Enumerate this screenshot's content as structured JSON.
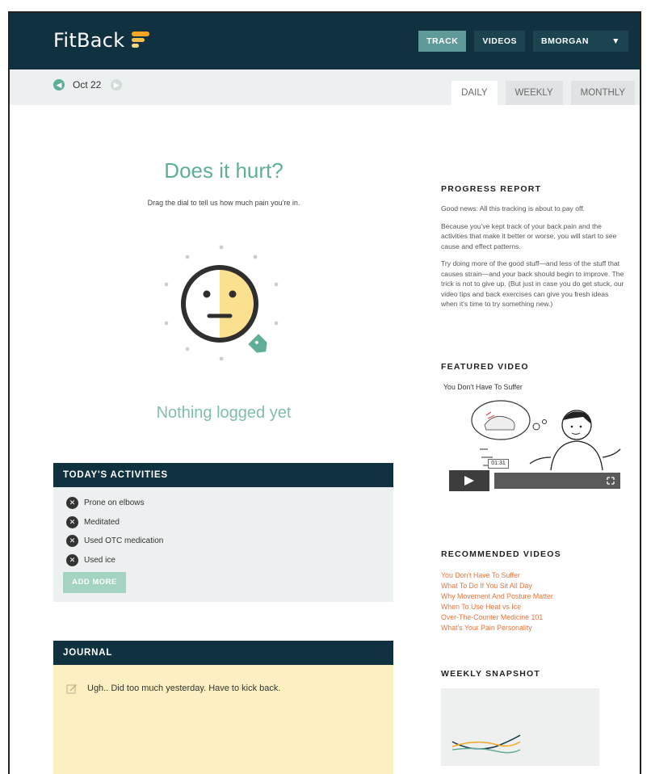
{
  "brand": {
    "name": "FitBack"
  },
  "nav": {
    "track": "TRACK",
    "videos": "VIDEOS",
    "user": "BMORGAN",
    "user_caret": "▼"
  },
  "datebar": {
    "date": "Oct 22",
    "tabs": [
      "DAILY",
      "WEEKLY",
      "MONTHLY"
    ],
    "active_tab": "DAILY"
  },
  "pain": {
    "title": "Does it hurt?",
    "instruction": "Drag the dial to tell us how much pain you're in.",
    "dial_value": "4",
    "status": "Nothing logged yet"
  },
  "activities": {
    "header": "TODAY'S ACTIVITIES",
    "items": [
      "Prone on elbows",
      "Meditated",
      "Used OTC medication",
      "Used ice"
    ],
    "add_more": "ADD MORE"
  },
  "journal": {
    "header": "JOURNAL",
    "entry": "Ugh.. Did too much yesterday. Have to kick back."
  },
  "progress": {
    "header": "PROGRESS REPORT",
    "paragraphs": [
      "Good news: All this tracking is about to pay off.",
      "Because you've kept track of your back pain and the activities that make it better or worse, you will start to see cause and effect patterns.",
      "Try doing more of the good stuff—and less of the stuff that causes strain—and your back should begin to improve. The trick is not to give up. (But just in case you do get stuck, our video tips and back exercises can give you fresh ideas when it's time to try something new.)"
    ]
  },
  "featured": {
    "header": "FEATURED VIDEO",
    "title": "You Don't Have To Suffer",
    "time": "01:31"
  },
  "recommended": {
    "header": "RECOMMENDED VIDEOS",
    "links": [
      "You Don't Have To Suffer",
      "What To Do If You Sit All Day",
      "Why Movement And Posture Matter",
      "When To Use Heat vs Ice",
      "Over-The-Counter Medicine 101",
      "What's Your Pain Personality"
    ]
  },
  "snapshot": {
    "header": "WEEKLY SNAPSHOT"
  },
  "colors": {
    "navy": "#0f3140",
    "teal": "#5fae97",
    "active_tab": "#5e9a9a",
    "journal_bg": "#fcefc0",
    "link": "#e8743a",
    "dial_fill": "#fbe08f"
  }
}
